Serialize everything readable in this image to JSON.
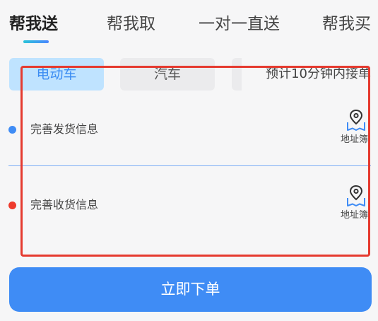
{
  "tabs": [
    {
      "label": "帮我送",
      "active": true
    },
    {
      "label": "帮我取",
      "active": false
    },
    {
      "label": "一对一直送",
      "active": false
    },
    {
      "label": "帮我买",
      "active": false
    }
  ],
  "vehicles": [
    {
      "label": "电动车",
      "selected": true
    },
    {
      "label": "汽车",
      "selected": false
    }
  ],
  "eta_text": "预计10分钟内接单",
  "sender": {
    "label": "完善发货信息",
    "dot_color": "#3f8cf5",
    "address_book_label": "地址簿",
    "icon": "map-pin-icon"
  },
  "receiver": {
    "label": "完善收货信息",
    "dot_color": "#ee3a2c",
    "address_book_label": "地址簿",
    "icon": "map-pin-icon"
  },
  "submit_label": "立即下单",
  "colors": {
    "accent": "#3f8cf5",
    "highlight": "#e53a2f",
    "selected_vehicle_bg": "#bfe3ff"
  }
}
